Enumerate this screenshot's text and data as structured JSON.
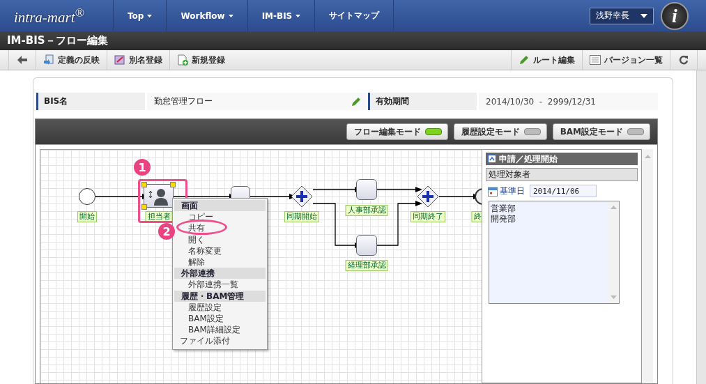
{
  "header": {
    "logo": "intra-mart$^{®}$",
    "menus": [
      {
        "label": "Top",
        "dropdown": true
      },
      {
        "label": "Workflow",
        "dropdown": true
      },
      {
        "label": "IM-BIS",
        "dropdown": true
      },
      {
        "label": "サイトマップ",
        "dropdown": false
      }
    ],
    "user": "浅野幸長",
    "badge": "i"
  },
  "page_title": "IM-BIS－フロー編集",
  "toolbar": {
    "left": [
      {
        "kind": "reflect",
        "label": "定義の反映"
      },
      {
        "kind": "alias",
        "label": "別名登録"
      },
      {
        "kind": "new",
        "label": "新規登録"
      }
    ],
    "right": [
      {
        "kind": "edit",
        "label": "ルート編集"
      },
      {
        "kind": "list",
        "label": "バージョン一覧"
      }
    ]
  },
  "bis": {
    "name_label": "BIS名",
    "name": "勤怠管理フロー",
    "period_label": "有効期間",
    "period": "2014/10/30  -  2999/12/31"
  },
  "modes": [
    {
      "label": "フロー編集モード",
      "on": true
    },
    {
      "label": "履歴設定モード",
      "on": false
    },
    {
      "label": "BAM設定モード",
      "on": false
    }
  ],
  "diagram": {
    "nodes": [
      {
        "kind": "start",
        "label": "開始",
        "selected": false
      },
      {
        "kind": "user_task",
        "label": "担当者",
        "selected": true
      },
      {
        "kind": "task",
        "selected": false
      },
      {
        "kind": "gateway",
        "label": "同期開始",
        "selected": false
      },
      {
        "kind": "task",
        "label": "人事部承認",
        "selected": false
      },
      {
        "kind": "task",
        "label": "経理部承認",
        "selected": false
      },
      {
        "kind": "gateway",
        "label": "同期終了",
        "selected": false
      },
      {
        "kind": "end",
        "label": "終",
        "selected": false
      }
    ],
    "annotations": [
      {
        "number": "1"
      },
      {
        "number": "2"
      }
    ],
    "context_menu": [
      {
        "kind": "header",
        "label": "画面"
      },
      {
        "kind": "item",
        "label": "コピー"
      },
      {
        "kind": "item",
        "label": "共有"
      },
      {
        "kind": "item",
        "label": "開く"
      },
      {
        "kind": "item",
        "label": "名称変更"
      },
      {
        "kind": "item",
        "label": "解除"
      },
      {
        "kind": "header",
        "label": "外部連携"
      },
      {
        "kind": "item",
        "label": "外部連携一覧"
      },
      {
        "kind": "header",
        "label": "履歴・BAM管理"
      },
      {
        "kind": "item",
        "label": "履歴設定"
      },
      {
        "kind": "item",
        "label": "BAM設定"
      },
      {
        "kind": "item",
        "label": "BAM詳細設定"
      },
      {
        "kind": "top",
        "label": "ファイル添付"
      }
    ]
  },
  "panel": {
    "title": "申請／処理開始",
    "section": "処理対象者",
    "date_label": "基準日",
    "date": "2014/11/06",
    "items": [
      "営業部",
      "開発部"
    ]
  }
}
